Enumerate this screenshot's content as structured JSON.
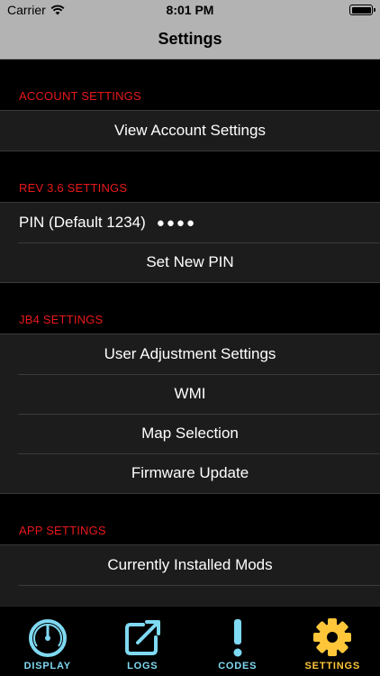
{
  "status_bar": {
    "carrier": "Carrier",
    "time": "8:01 PM"
  },
  "nav": {
    "title": "Settings"
  },
  "sections": {
    "account": {
      "header": "ACCOUNT SETTINGS",
      "rows": [
        "View Account Settings"
      ]
    },
    "rev": {
      "header": "REV 3.6 SETTINGS",
      "pin_label": "PIN (Default 1234)",
      "pin_value": "●●●●",
      "set_pin": "Set New PIN"
    },
    "jb4": {
      "header": "JB4 SETTINGS",
      "rows": [
        "User Adjustment Settings",
        "WMI",
        "Map Selection",
        "Firmware Update"
      ]
    },
    "app": {
      "header": "APP SETTINGS",
      "rows": [
        "Currently Installed Mods"
      ]
    }
  },
  "tabs": [
    {
      "label": "DISPLAY",
      "icon": "gauge-icon"
    },
    {
      "label": "LOGS",
      "icon": "export-log-icon"
    },
    {
      "label": "CODES",
      "icon": "exclamation-icon"
    },
    {
      "label": "SETTINGS",
      "icon": "gear-icon",
      "active": true
    }
  ],
  "colors": {
    "section_header": "#e8191c",
    "tab_inactive": "#7fd9f2",
    "tab_active": "#ffc63a",
    "bars": "#b3b3b3"
  }
}
